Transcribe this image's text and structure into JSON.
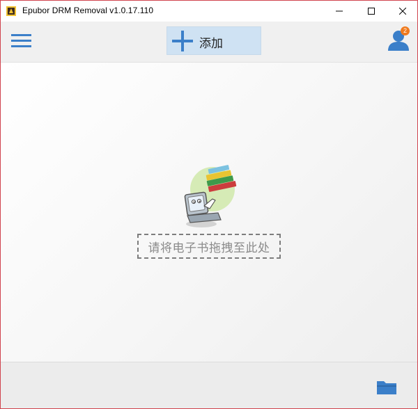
{
  "window": {
    "title": "Epubor DRM Removal v1.0.17.110",
    "controls": {
      "minimize": "minimize-icon",
      "maximize": "maximize-icon",
      "close": "close-icon"
    }
  },
  "toolbar": {
    "menu_icon": "hamburger-menu-icon",
    "add_label": "添加",
    "add_icon": "plus-icon",
    "user_icon": "user-icon",
    "notification_count": "2"
  },
  "main": {
    "illustration": "books-computer-mascot-icon",
    "dropzone_text": "请将电子书拖拽至此处"
  },
  "footer": {
    "folder_icon": "folder-icon"
  },
  "colors": {
    "accent_blue": "#3b7fc9",
    "add_button_bg": "#cfe2f3",
    "badge": "#f07a1e",
    "window_border": "#d0434e"
  }
}
